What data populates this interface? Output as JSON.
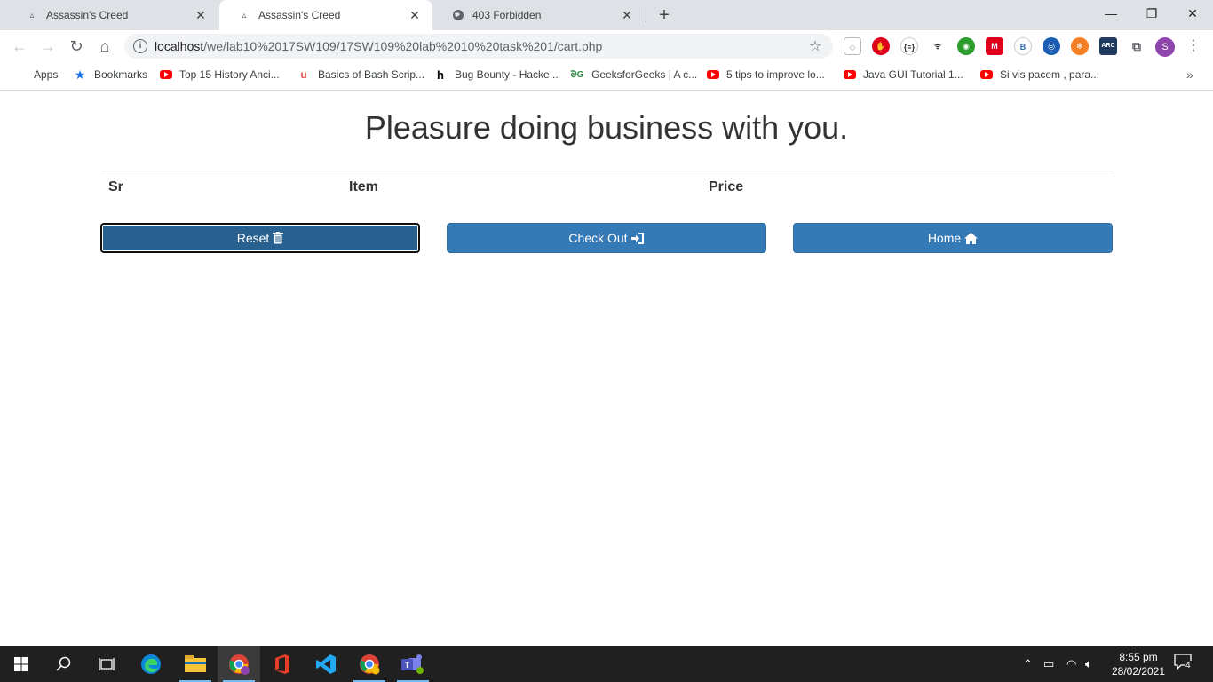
{
  "browser": {
    "tabs": [
      {
        "title": "Assassin's Creed",
        "active": false
      },
      {
        "title": "Assassin's Creed",
        "active": true
      },
      {
        "title": "403 Forbidden",
        "active": false
      }
    ],
    "url_host": "localhost",
    "url_path": "/we/lab10%2017SW109/17SW109%20lab%2010%20task%201/cart.php",
    "bookmarks": [
      {
        "label": "Apps",
        "icon": "apps-grid-icon"
      },
      {
        "label": "Bookmarks",
        "icon": "star-icon"
      },
      {
        "label": "Top 15 History Anci...",
        "icon": "youtube-icon"
      },
      {
        "label": "Basics of Bash Scrip...",
        "icon": "udemy-icon"
      },
      {
        "label": "Bug Bounty - Hacke...",
        "icon": "hackerone-icon"
      },
      {
        "label": "GeeksforGeeks | A c...",
        "icon": "gfg-icon"
      },
      {
        "label": "5 tips to improve lo...",
        "icon": "youtube-icon"
      },
      {
        "label": "Java GUI Tutorial 1...",
        "icon": "youtube-icon"
      },
      {
        "label": "Si vis pacem , para...",
        "icon": "youtube-icon"
      }
    ],
    "profile_initial": "S"
  },
  "page": {
    "title": "Pleasure doing business with you.",
    "table_headers": [
      "Sr",
      "Item",
      "Price"
    ],
    "buttons": {
      "reset": "Reset",
      "checkout": "Check Out",
      "home": "Home"
    },
    "colors": {
      "button_primary": "#337ab7",
      "button_focused": "#286090"
    }
  },
  "taskbar": {
    "time": "8:55 pm",
    "date": "28/02/2021",
    "notification_count": "4"
  }
}
